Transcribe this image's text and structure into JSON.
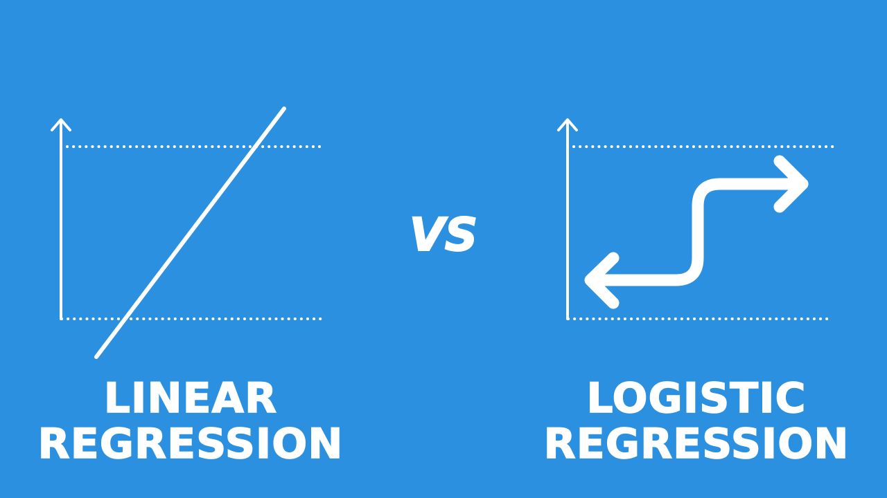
{
  "left_panel": {
    "title_line1": "LINEAR",
    "title_line2": "REGRESSION"
  },
  "separator": {
    "text": "VS"
  },
  "right_panel": {
    "title_line1": "LOGISTIC",
    "title_line2": "REGRESSION"
  },
  "colors": {
    "background": "#2b90df",
    "foreground": "#ffffff"
  }
}
